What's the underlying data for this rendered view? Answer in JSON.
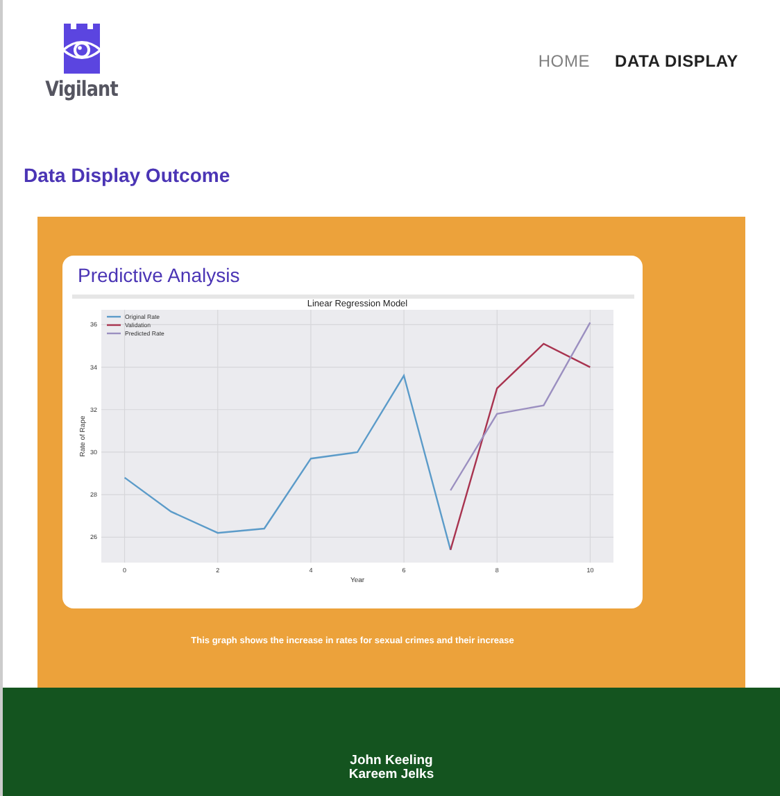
{
  "logo": {
    "text": "Vigilant"
  },
  "nav": [
    {
      "label": "HOME",
      "selected": false
    },
    {
      "label": "DATA DISPLAY",
      "selected": true
    }
  ],
  "heading": "Data Display Outcome",
  "card": {
    "title": "Predictive Analysis",
    "chart_data": {
      "type": "line",
      "title": "Linear Regression Model",
      "xlabel": "Year",
      "ylabel": "Rate of Rape",
      "grid": true,
      "legend": true,
      "xlim": [
        -0.5,
        10.5
      ],
      "ylim": [
        24.8,
        36.7
      ],
      "xticks": [
        0,
        2,
        4,
        6,
        8,
        10
      ],
      "yticks": [
        26,
        28,
        30,
        32,
        34,
        36
      ],
      "x": [
        0,
        1,
        2,
        3,
        4,
        5,
        6,
        7,
        8,
        9,
        10
      ],
      "series": [
        {
          "name": "Original Rate",
          "color": "#5b9bc9",
          "values": [
            28.8,
            27.2,
            26.2,
            26.4,
            29.7,
            30.0,
            33.6,
            25.4,
            null,
            null,
            null
          ]
        },
        {
          "name": "Validation",
          "color": "#a8334f",
          "values": [
            null,
            null,
            null,
            null,
            null,
            null,
            null,
            25.4,
            33.0,
            35.1,
            34.0
          ]
        },
        {
          "name": "Predicted Rate",
          "color": "#9b8fc0",
          "values": [
            null,
            null,
            null,
            null,
            null,
            null,
            null,
            28.2,
            31.8,
            32.2,
            36.1
          ]
        }
      ]
    }
  },
  "caption": "This graph shows the increase in rates for sexual crimes and their increase",
  "footer": {
    "names": [
      "John Keeling",
      "Kareem Jelks"
    ]
  }
}
